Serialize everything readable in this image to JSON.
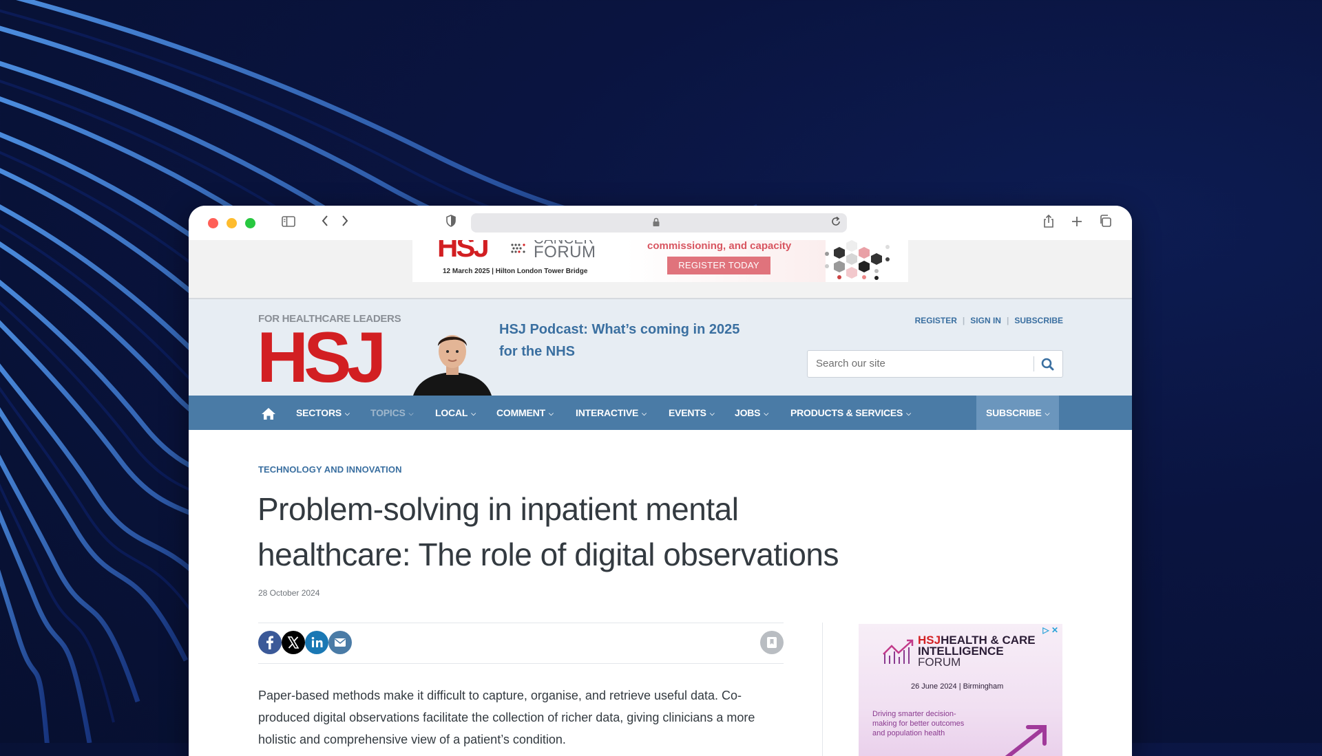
{
  "browser": {
    "url_lock_icon": "lock-icon",
    "icons": [
      "sidebar-toggle-icon",
      "back-icon",
      "forward-icon",
      "shield-icon",
      "reload-icon",
      "share-icon",
      "new-tab-icon",
      "tabs-overview-icon"
    ],
    "traffic_colors": {
      "close": "#ff5f57",
      "minimize": "#febc2e",
      "zoom": "#28c840"
    }
  },
  "top_ad": {
    "brand": "HSJ",
    "event_partial": "CANCER",
    "event": "FORUM",
    "date_venue": "12 March 2025 | Hilton London Tower Bridge",
    "tagline": "commissioning, and capacity",
    "cta": "REGISTER TODAY"
  },
  "header": {
    "logo_tagline": "FOR HEALTHCARE LEADERS",
    "logo_text": "HSJ",
    "podcast_link": "HSJ Podcast: What’s coming in 2025 for the NHS",
    "account_links": [
      "REGISTER",
      "SIGN IN",
      "SUBSCRIBE"
    ],
    "search": {
      "placeholder": "Search our site"
    }
  },
  "nav": {
    "home_icon": "home-icon",
    "items": [
      {
        "label": "SECTORS"
      },
      {
        "label": "TOPICS"
      },
      {
        "label": "LOCAL"
      },
      {
        "label": "COMMENT"
      },
      {
        "label": "INTERACTIVE"
      },
      {
        "label": "EVENTS"
      },
      {
        "label": "JOBS"
      },
      {
        "label": "PRODUCTS & SERVICES"
      }
    ],
    "subscribe": "SUBSCRIBE"
  },
  "article": {
    "category": "TECHNOLOGY AND INNOVATION",
    "title": "Problem-solving in inpatient mental healthcare: The role of digital observations",
    "date": "28 October 2024",
    "share": [
      "facebook-icon",
      "x-icon",
      "linkedin-icon",
      "email-icon"
    ],
    "body": "Paper-based methods make it difficult to capture, organise, and retrieve useful data. Co-produced digital observations facilitate the collection of richer data, giving clinicians a more holistic and comprehensive view of a patient’s condition."
  },
  "side_ad": {
    "brand": "HSJ",
    "title_line1": "HEALTH & CARE",
    "title_line2": "INTELLIGENCE",
    "title_line3": "FORUM",
    "date": "26 June 2024 | Birmingham",
    "description": "Driving smarter decision-making for better outcomes and population health"
  },
  "colors": {
    "brand_red": "#d21f22",
    "link_blue": "#3a6fa0",
    "nav_blue": "#4a7ba6",
    "header_bg": "#e7edf3"
  }
}
